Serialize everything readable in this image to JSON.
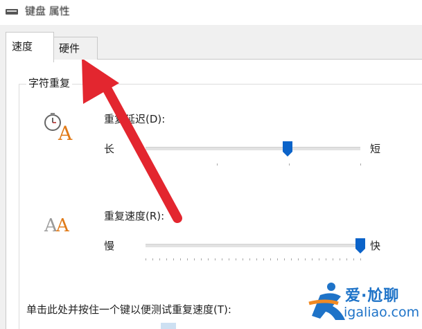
{
  "window": {
    "title": "键盘 属性"
  },
  "tabs": [
    {
      "label": "速度",
      "selected": true
    },
    {
      "label": "硬件",
      "selected": false
    }
  ],
  "character_repeat": {
    "group_label": "字符重复",
    "repeat_delay": {
      "label": "重复延迟(D):",
      "min_label": "长",
      "max_label": "短",
      "value_fraction": 0.66
    },
    "repeat_rate": {
      "label": "重复速度(R):",
      "min_label": "慢",
      "max_label": "快",
      "value_fraction": 1.0
    },
    "test_label": "单击此处并按住一个键以便测试重复速度(T):"
  },
  "watermark": {
    "text": "爱·尬聊",
    "url": "igaliao.com"
  },
  "colors": {
    "accent": "#0b63c9",
    "annotation_arrow": "#e3262f",
    "icon_letter": "#e07a18"
  },
  "icons": {
    "title": "keyboard-icon",
    "repeat_delay": "clock-letter-a-icon",
    "repeat_rate": "double-letter-a-icon"
  }
}
